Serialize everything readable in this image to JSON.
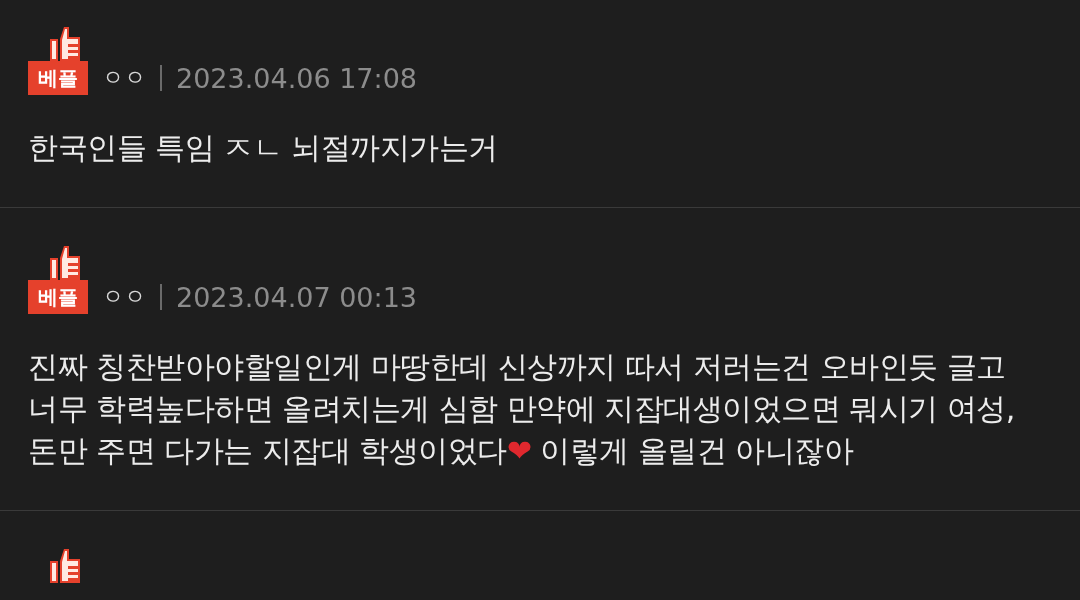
{
  "comments": [
    {
      "best": true,
      "badge": "베플",
      "author": "ㅇㅇ",
      "date": "2023.04.06 17:08",
      "segments": [
        {
          "kind": "text",
          "text": "한국인들 특임 ㅈㄴ 뇌절까지가는거"
        }
      ]
    },
    {
      "best": true,
      "badge": "베플",
      "author": "ㅇㅇ",
      "date": "2023.04.07 00:13",
      "segments": [
        {
          "kind": "text",
          "text": "진짜 칭찬받아야할일인게 마땅한데 신상까지 따서 저러는건 오바인듯 글고 너무 학력높다하면 올려치는게 심함 만약에 지잡대생이었으면 뭐시기 여성, 돈만 주면 다가는 지잡대 학생이었다"
        },
        {
          "kind": "emoji",
          "text": "❤"
        },
        {
          "kind": "text",
          "text": " 이렇게 올릴건 아니잖아"
        }
      ]
    },
    {
      "best": true
    }
  ]
}
